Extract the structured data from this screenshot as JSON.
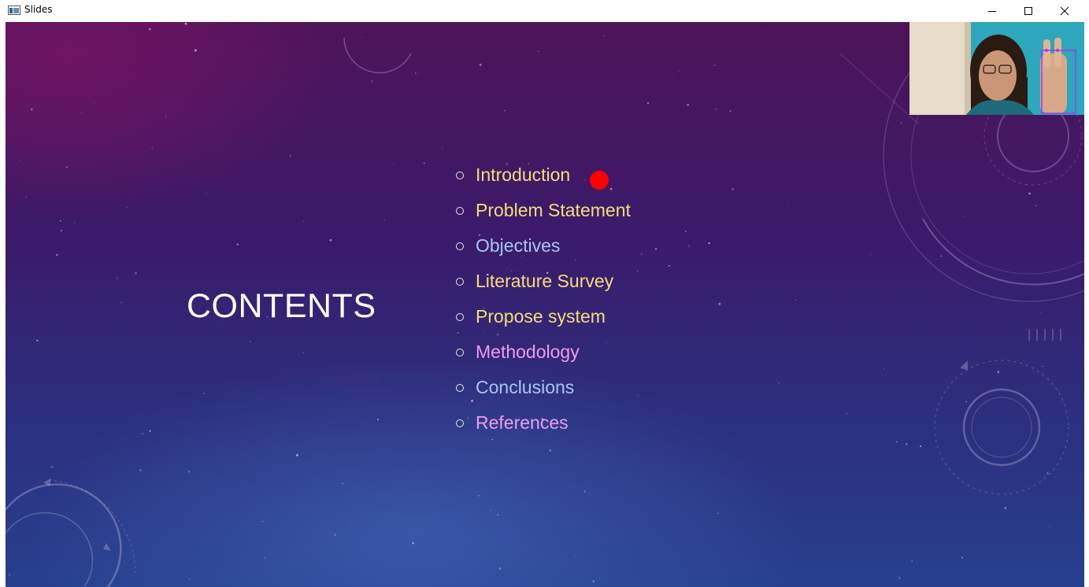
{
  "window": {
    "title": "Slides",
    "icon": "app-window-icon",
    "controls": [
      "minimize-icon",
      "maximize-icon",
      "close-icon"
    ]
  },
  "slide": {
    "title": "CONTENTS",
    "items": [
      {
        "label": "Introduction",
        "color": "#f5de7a"
      },
      {
        "label": "Problem Statement",
        "color": "#f5de7a"
      },
      {
        "label": "Objectives",
        "color": "#a9c6f5"
      },
      {
        "label": "Literature Survey",
        "color": "#f5de7a"
      },
      {
        "label": "Propose system",
        "color": "#f5de7a"
      },
      {
        "label": "Methodology",
        "color": "#ee9cf0"
      },
      {
        "label": "Conclusions",
        "color": "#a9c6f5"
      },
      {
        "label": "References",
        "color": "#ee9cf0"
      }
    ],
    "pointer_color": "#ff0000"
  },
  "colors": {
    "background_top": "#4e1459",
    "background_bottom": "#27408e"
  }
}
